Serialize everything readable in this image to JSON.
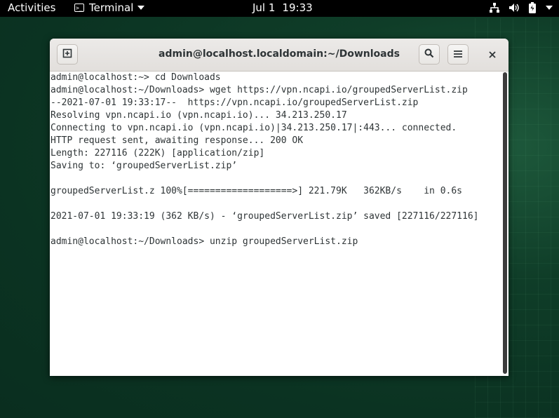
{
  "topbar": {
    "activities": "Activities",
    "app_name": "Terminal",
    "date": "Jul 1",
    "time": "19:33"
  },
  "window": {
    "title": "admin@localhost.localdomain:~/Downloads"
  },
  "terminal": {
    "lines": [
      "admin@localhost:~> cd Downloads",
      "admin@localhost:~/Downloads> wget https://vpn.ncapi.io/groupedServerList.zip",
      "--2021-07-01 19:33:17--  https://vpn.ncapi.io/groupedServerList.zip",
      "Resolving vpn.ncapi.io (vpn.ncapi.io)... 34.213.250.17",
      "Connecting to vpn.ncapi.io (vpn.ncapi.io)|34.213.250.17|:443... connected.",
      "HTTP request sent, awaiting response... 200 OK",
      "Length: 227116 (222K) [application/zip]",
      "Saving to: ‘groupedServerList.zip’",
      "",
      "groupedServerList.z 100%[===================>] 221.79K   362KB/s    in 0.6s",
      "",
      "2021-07-01 19:33:19 (362 KB/s) - ‘groupedServerList.zip’ saved [227116/227116]",
      "",
      "admin@localhost:~/Downloads> unzip groupedServerList.zip"
    ]
  },
  "icons": {
    "network": "network-icon",
    "volume": "volume-icon",
    "battery": "battery-icon",
    "power": "power-icon"
  },
  "colors": {
    "topbar_bg": "#000000",
    "desktop_bg": "#0b3322",
    "terminal_fg": "#2e3436"
  }
}
